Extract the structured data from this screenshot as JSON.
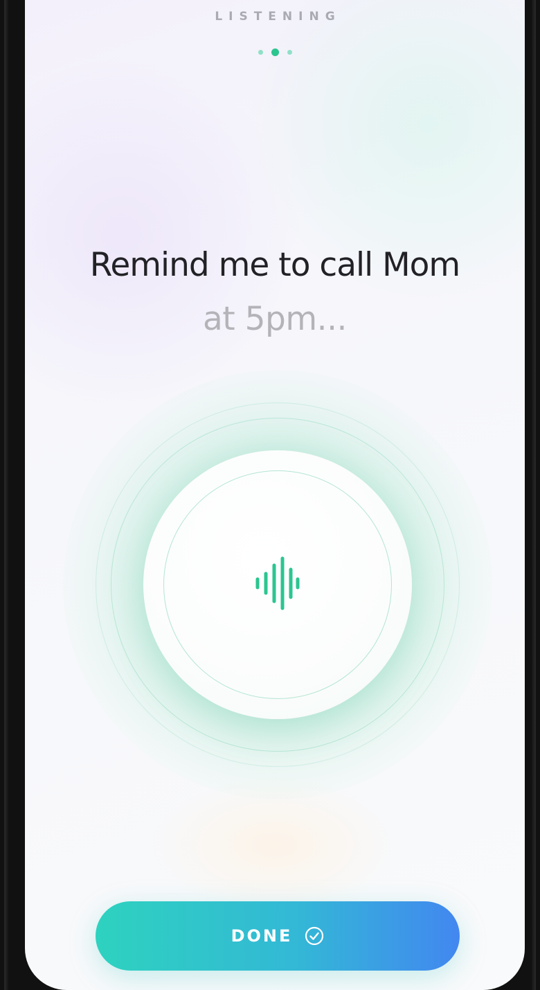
{
  "status": {
    "label": "LISTENING",
    "page_dots": {
      "count": 3,
      "active_index": 1
    }
  },
  "transcript": {
    "line1": "Remind me to call Mom",
    "line2": "at 5pm..."
  },
  "mic": {
    "icon": "audio-wave-icon",
    "state": "listening"
  },
  "done_button": {
    "label": "DONE",
    "icon": "check-circle-icon"
  },
  "colors": {
    "accent": "#2cc590",
    "button_gradient_start": "#2ed2bf",
    "button_gradient_end": "#4287f0",
    "transcript_primary": "#222226",
    "transcript_secondary": "#b3b3b8"
  }
}
